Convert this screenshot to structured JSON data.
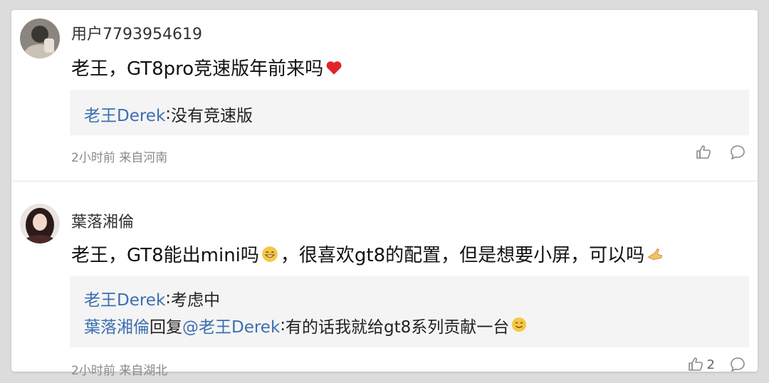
{
  "comments": [
    {
      "username": "用户7793954619",
      "text_prefix": "老王，GT8pro竞速版年前来吗",
      "emoji_after_text": "red-heart",
      "replies": [
        {
          "author": "老王Derek",
          "sep": ":",
          "content": "没有竞速版"
        }
      ],
      "time_location": "2小时前 来自河南",
      "like_count": ""
    },
    {
      "username": "葉落湘倫",
      "text_part1": "老王，GT8能出mini吗",
      "emoji_mid": "grin-face",
      "text_part2": "，很喜欢gt8的配置，但是想要小屏，可以吗",
      "emoji_end": "praying-hands",
      "replies": [
        {
          "author": "老王Derek",
          "sep": ":",
          "content": "考虑中"
        },
        {
          "author": "葉落湘倫",
          "mid": "回复",
          "mention": "@老王Derek",
          "sep": ":",
          "content": "有的话我就给gt8系列贡献一台",
          "emoji": "smile-face"
        }
      ],
      "time_location": "2小时前 来自湖北",
      "like_count": "2"
    }
  ],
  "colors": {
    "link": "#3c6fb0",
    "meta": "#8a8a8a",
    "reply_bg": "#f4f4f4"
  }
}
